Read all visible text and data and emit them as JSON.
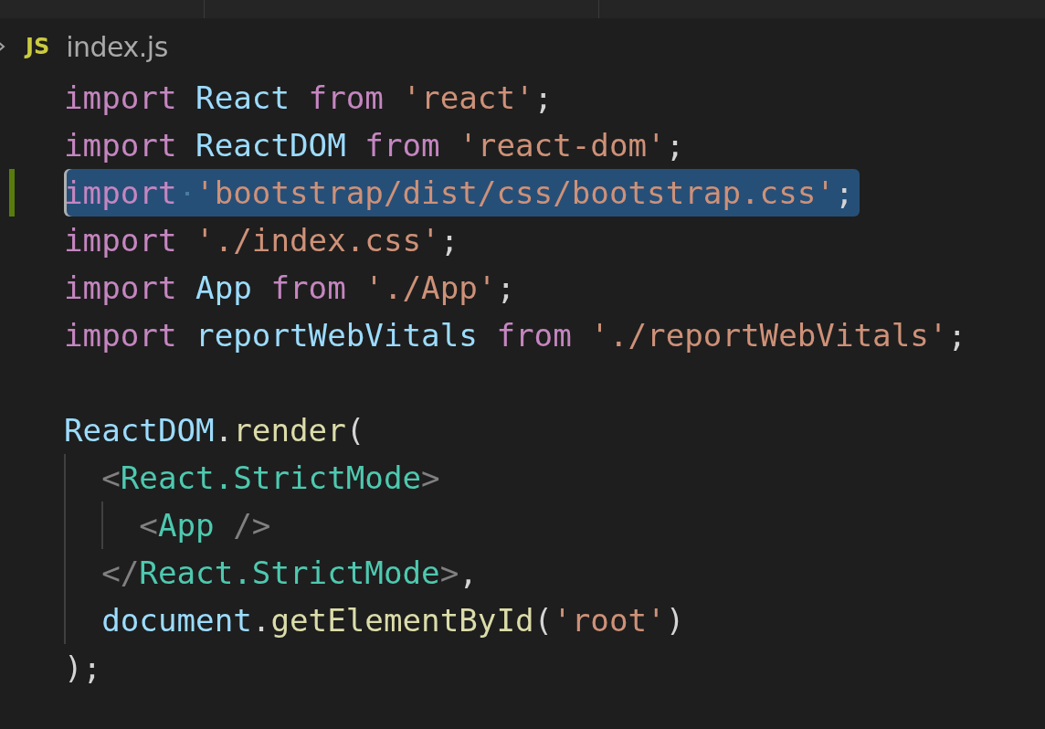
{
  "breadcrumb": {
    "file_badge": "JS",
    "file_name": "index.js"
  },
  "lines": [
    {
      "selected": false,
      "modified": false,
      "tokens": [
        {
          "text": "import ",
          "kind": "keyword"
        },
        {
          "text": "React ",
          "kind": "variable"
        },
        {
          "text": "from ",
          "kind": "keyword"
        },
        {
          "text": "'react'",
          "kind": "string"
        },
        {
          "text": ";",
          "kind": "punct"
        }
      ]
    },
    {
      "selected": false,
      "modified": false,
      "tokens": [
        {
          "text": "import ",
          "kind": "keyword"
        },
        {
          "text": "ReactDOM ",
          "kind": "variable"
        },
        {
          "text": "from ",
          "kind": "keyword"
        },
        {
          "text": "'react-dom'",
          "kind": "string"
        },
        {
          "text": ";",
          "kind": "punct"
        }
      ]
    },
    {
      "selected": true,
      "modified": true,
      "tokens": [
        {
          "text": "import ",
          "kind": "keyword"
        },
        {
          "text": "'bootstrap/dist/css/bootstrap.css'",
          "kind": "string"
        },
        {
          "text": ";",
          "kind": "punct"
        }
      ]
    },
    {
      "selected": false,
      "modified": false,
      "tokens": [
        {
          "text": "import ",
          "kind": "keyword"
        },
        {
          "text": "'./index.css'",
          "kind": "string"
        },
        {
          "text": ";",
          "kind": "punct"
        }
      ]
    },
    {
      "selected": false,
      "modified": false,
      "tokens": [
        {
          "text": "import ",
          "kind": "keyword"
        },
        {
          "text": "App ",
          "kind": "variable"
        },
        {
          "text": "from ",
          "kind": "keyword"
        },
        {
          "text": "'./App'",
          "kind": "string"
        },
        {
          "text": ";",
          "kind": "punct"
        }
      ]
    },
    {
      "selected": false,
      "modified": false,
      "tokens": [
        {
          "text": "import ",
          "kind": "keyword"
        },
        {
          "text": "reportWebVitals ",
          "kind": "variable"
        },
        {
          "text": "from ",
          "kind": "keyword"
        },
        {
          "text": "'./reportWebVitals'",
          "kind": "string"
        },
        {
          "text": ";",
          "kind": "punct"
        }
      ]
    },
    {
      "selected": false,
      "modified": false
    },
    {
      "selected": false,
      "modified": false,
      "tokens": [
        {
          "text": "ReactDOM",
          "kind": "variable"
        },
        {
          "text": ".",
          "kind": "punct"
        },
        {
          "text": "render",
          "kind": "function"
        },
        {
          "text": "(",
          "kind": "punct"
        }
      ]
    },
    {
      "selected": false,
      "modified": false,
      "tokens": [
        {
          "text": "  <",
          "kind": "bracket"
        },
        {
          "text": "React.StrictMode",
          "kind": "tag"
        },
        {
          "text": ">",
          "kind": "bracket"
        }
      ]
    },
    {
      "selected": false,
      "modified": false,
      "tokens": [
        {
          "text": "    <",
          "kind": "bracket"
        },
        {
          "text": "App ",
          "kind": "tag"
        },
        {
          "text": "/>",
          "kind": "bracket"
        }
      ]
    },
    {
      "selected": false,
      "modified": false,
      "tokens": [
        {
          "text": "  </",
          "kind": "bracket"
        },
        {
          "text": "React.StrictMode",
          "kind": "tag"
        },
        {
          "text": ">",
          "kind": "bracket"
        },
        {
          "text": ",",
          "kind": "punct"
        }
      ]
    },
    {
      "selected": false,
      "modified": false,
      "tokens": [
        {
          "text": "  document",
          "kind": "variable"
        },
        {
          "text": ".",
          "kind": "punct"
        },
        {
          "text": "getElementById",
          "kind": "function"
        },
        {
          "text": "(",
          "kind": "punct"
        },
        {
          "text": "'root'",
          "kind": "string"
        },
        {
          "text": ")",
          "kind": "punct"
        }
      ]
    },
    {
      "selected": false,
      "modified": false,
      "tokens": [
        {
          "text": ");",
          "kind": "punct"
        }
      ]
    }
  ]
}
